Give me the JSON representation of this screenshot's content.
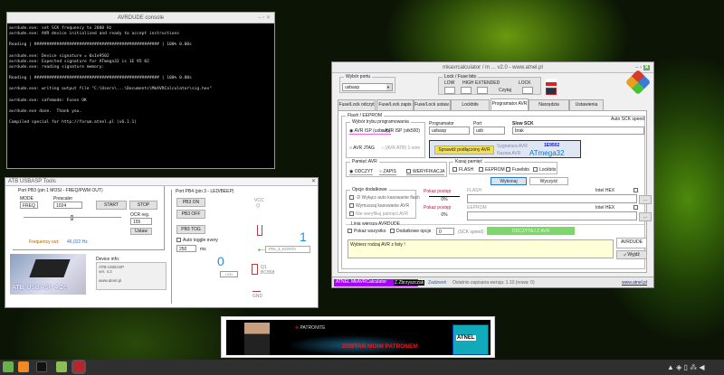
{
  "console": {
    "title": "AVRDUDE console",
    "lines": [
      "avrdude.exe: set SCK frequency to 2000 Hz",
      "avrdude.exe: AVR device initialized and ready to accept instructions",
      "",
      "Reading | ################################################## | 100% 0.00s",
      "",
      "avrdude.exe: Device signature = 0x1e9502",
      "avrdude.exe: Expected signature for ATmega32 is 1E 95 02",
      "avrdude.exe: reading signature memory:",
      "",
      "Reading | ################################################## | 100% 0.00s",
      "",
      "avrdude.exe: writing output file \"C:\\Users\\...\\Documents\\MkAVRCalculator\\sig.hex\"",
      "",
      "avrdude.exe: safemode: Fuses OK",
      "",
      "avrdude.exe done.  Thank you.",
      "",
      "Compiled special for http://forum.atnel.pl (v6.1.1)"
    ]
  },
  "main": {
    "title": "mkavrcalculator / m ... v2.0 - www.atnel.pl",
    "port_group": "Wybór portu",
    "port_value": "usbasp",
    "fuse_group": "Lock / Fuse bits",
    "fuse_labels": [
      "LOW",
      "HIGH",
      "EXTENDED",
      "LOCK"
    ],
    "fuse_read": "Czytaj",
    "tabs": [
      "Fuse/Lock odczyt",
      "Fuse/Lock zapis",
      "Fuse/Lock ustaw.",
      "Lockbits",
      "Programator AVR",
      "Narzędzia",
      "Ustawienia"
    ],
    "prog_group": "Flash / EEPROM",
    "mode_group": "Wybór trybu programowania",
    "modes": [
      "AVR ISP (usbasp)",
      "AVR ISP (stk500)",
      "AVR JTAG",
      "(AVR ATB) 1-wire"
    ],
    "programmer_label": "Programator",
    "programmer_value": "usbasp",
    "port_label": "Port",
    "port_sel": "usb",
    "sck_label": "Slow SCK",
    "sck_value": "brak",
    "auto_sck": "Auto SCK speed",
    "detect_btn": "Sprawdź podłączony AVR",
    "signature_label": "Sygnatura AVR",
    "signature_value": "1E9502",
    "name_label": "Nazwa AVR",
    "name_value": "ATmega32",
    "memory_group": "Pamięć AVR",
    "mem_opts": [
      "ODCZYT",
      "ZAPIS",
      "WERYFIKACJA"
    ],
    "erase_group": "Kasuj pamięć",
    "erase_opts": [
      "FLASH",
      "EEPROM",
      "Fusebits",
      "Lockbits"
    ],
    "exec_btn": "Wykonaj",
    "clear_btn": "Wyczyść",
    "extra_group": "Opcje dodatkowe",
    "extra_opts": [
      "-D Wyłącz auto kasowanie flash",
      "Wymuszaj kasowanie AVR",
      "Nie weryfikuj pamięci AVR"
    ],
    "progress_label": "Pokaż postęp",
    "progress_value": "0%",
    "flash_label": "FLASH",
    "eeprom_label": "EEPROM",
    "hex_check": "Intel HEX",
    "browse": "...",
    "avrdude_group": "Linia wiersza AVRDUDE",
    "verbose": "Pokaż wszystko",
    "extra_cmd": "Dodatkowe opcje",
    "speed_value": "0",
    "speed_label": "(SCK speed)",
    "write_btn": "ODCZYTAJ Z AVR",
    "message": "Wybierz rodzaj AVR z listy !",
    "console_btn": "AVRDUDE",
    "exit_btn": "Wyjdź",
    "status_left": "ATNEL MkAVRCalculator",
    "status_badge": "Z.Zbrzyszczak",
    "status_link": "Zadzwoń",
    "status_version": "Ostatnio zapisana wersja: 1.10 (nowa: 0)",
    "status_site": "www.atnel.pl"
  },
  "tool": {
    "title": "ATB USBASP Tools",
    "left_group": "Port PB3 (pin 1 MOSI - FREQ/PWM OUT)",
    "mode_label": "MODE",
    "mode_value": "FREQ",
    "presc_label": "Prescaler",
    "presc_value": "1024",
    "start": "START",
    "stop": "STOP",
    "ocr_label": "OCR reg.",
    "ocr_value": "155",
    "save": "Ustaw",
    "freq_label": "Frequency out:",
    "freq_value": "46,022 Hz",
    "device_label": "Device info:",
    "device_lines": [
      "ATB-USBASP",
      "ver. 4.2",
      "",
      "www.atnel.pl"
    ],
    "logo_text": "ATB-USBASP 4.2e",
    "right_group": "Port PB4 (pin 3 - LED/BEEP)",
    "on": "PB3 ON",
    "off": "PB3 OFF",
    "tog": "PB3 TOG",
    "auto_label": "Auto toggle every",
    "auto_value": "250",
    "ms": "ms",
    "vcc": "VCC",
    "gnd": "GND",
    "q1": "Q1",
    "q1_type": "BC858",
    "pin": "PIN_3_KONTA",
    "state_one": "1",
    "state_zero": "0",
    "led": "LED"
  },
  "banner": {
    "patronite": "PATRONITE",
    "cta": "ZOSTAŃ MOIM PATRONEM",
    "brand": "ATNEL"
  },
  "taskbar": {
    "icons": [
      "mint-menu-icon",
      "firefox-icon",
      "terminal-icon",
      "files-icon",
      "app-icon"
    ]
  }
}
